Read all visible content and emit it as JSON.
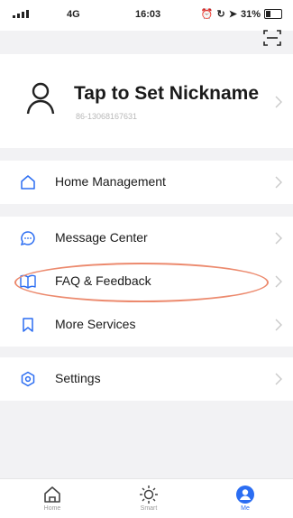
{
  "status_bar": {
    "network": "4G",
    "time": "16:03",
    "battery": "31%",
    "battery_level": 0.31
  },
  "profile": {
    "nickname": "Tap to Set Nickname",
    "phone": "86-13068167631"
  },
  "menu": {
    "home_management": "Home Management",
    "message_center": "Message Center",
    "faq_feedback": "FAQ & Feedback",
    "more_services": "More Services",
    "settings": "Settings"
  },
  "tabs": [
    {
      "label": "Home",
      "icon": "home-icon",
      "active": false
    },
    {
      "label": "Smart",
      "icon": "sun-icon",
      "active": false
    },
    {
      "label": "Me",
      "icon": "person-icon",
      "active": true
    }
  ],
  "colors": {
    "accent": "#2b6df2",
    "highlight": "#ec8a6e"
  }
}
